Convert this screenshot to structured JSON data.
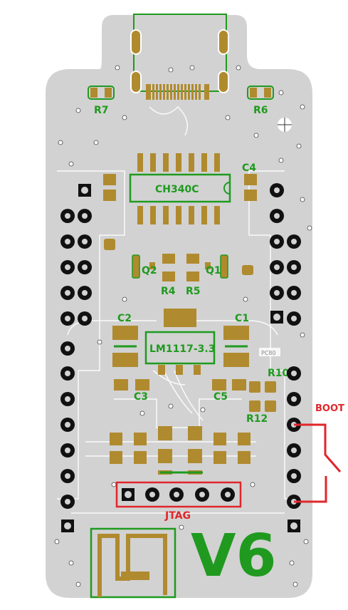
{
  "labels": {
    "r7": "R7",
    "r6": "R6",
    "ch340": "CH340C",
    "c4": "C4",
    "q2": "Q2",
    "q1": "Q1",
    "r4": "R4",
    "r5": "R5",
    "c2": "C2",
    "c1": "C1",
    "ldo": "LM1117-3.3",
    "c3": "C3",
    "c5": "C5",
    "r10": "R10",
    "r12": "R12",
    "jtag": "JTAG",
    "boot": "BOOT",
    "version": "V6",
    "pc80": "PC80"
  },
  "colors": {
    "board": "#d2d2d2",
    "pad": "#b08a2e",
    "silk_green": "#1f9a1f",
    "annotation_red": "#e0262b",
    "hole": "#111111"
  }
}
